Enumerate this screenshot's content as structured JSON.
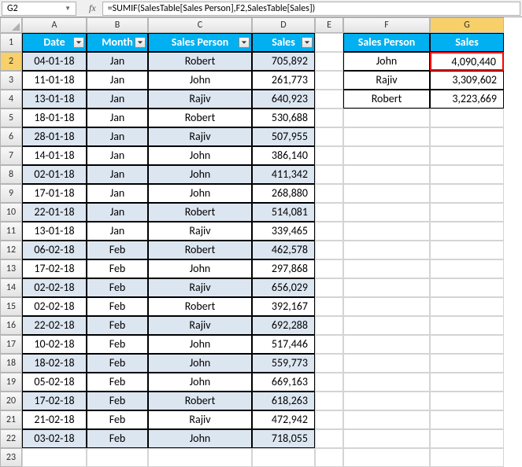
{
  "name_box": "G2",
  "fx_label": "fx",
  "formula": "=SUMIF(SalesTable[Sales Person],F2,SalesTable[Sales])",
  "columns": [
    "A",
    "B",
    "C",
    "D",
    "E",
    "F",
    "G"
  ],
  "rows": [
    "1",
    "2",
    "3",
    "4",
    "5",
    "6",
    "7",
    "8",
    "9",
    "10",
    "11",
    "12",
    "13",
    "14",
    "15",
    "16",
    "17",
    "18",
    "19",
    "20",
    "21",
    "22",
    "23"
  ],
  "selected_col": "G",
  "selected_row": "2",
  "table_headers": {
    "date": "Date",
    "month": "Month",
    "sales_person": "Sales Person",
    "sales": "Sales"
  },
  "table_rows": [
    {
      "date": "04-01-18",
      "month": "Jan",
      "person": "Robert",
      "sales": "705,892",
      "band": true
    },
    {
      "date": "11-01-18",
      "month": "Jan",
      "person": "John",
      "sales": "261,773",
      "band": false
    },
    {
      "date": "13-01-18",
      "month": "Jan",
      "person": "Rajiv",
      "sales": "640,923",
      "band": true
    },
    {
      "date": "18-01-18",
      "month": "Jan",
      "person": "Robert",
      "sales": "530,688",
      "band": false
    },
    {
      "date": "28-01-18",
      "month": "Jan",
      "person": "Rajiv",
      "sales": "507,955",
      "band": true
    },
    {
      "date": "14-01-18",
      "month": "Jan",
      "person": "John",
      "sales": "386,140",
      "band": false
    },
    {
      "date": "02-01-18",
      "month": "Jan",
      "person": "John",
      "sales": "411,342",
      "band": true
    },
    {
      "date": "17-01-18",
      "month": "Jan",
      "person": "John",
      "sales": "268,880",
      "band": false
    },
    {
      "date": "22-01-18",
      "month": "Jan",
      "person": "Robert",
      "sales": "514,081",
      "band": true
    },
    {
      "date": "13-01-18",
      "month": "Jan",
      "person": "Rajiv",
      "sales": "339,465",
      "band": false
    },
    {
      "date": "06-02-18",
      "month": "Feb",
      "person": "Robert",
      "sales": "462,578",
      "band": true
    },
    {
      "date": "17-02-18",
      "month": "Feb",
      "person": "John",
      "sales": "297,868",
      "band": false
    },
    {
      "date": "02-02-18",
      "month": "Feb",
      "person": "Rajiv",
      "sales": "656,029",
      "band": true
    },
    {
      "date": "02-02-18",
      "month": "Feb",
      "person": "Robert",
      "sales": "392,167",
      "band": false
    },
    {
      "date": "22-02-18",
      "month": "Feb",
      "person": "Rajiv",
      "sales": "692,288",
      "band": true
    },
    {
      "date": "10-02-18",
      "month": "Feb",
      "person": "John",
      "sales": "517,446",
      "band": false
    },
    {
      "date": "18-02-18",
      "month": "Feb",
      "person": "John",
      "sales": "559,773",
      "band": true
    },
    {
      "date": "05-02-18",
      "month": "Feb",
      "person": "John",
      "sales": "669,163",
      "band": false
    },
    {
      "date": "17-02-18",
      "month": "Feb",
      "person": "Robert",
      "sales": "618,263",
      "band": true
    },
    {
      "date": "21-02-18",
      "month": "Feb",
      "person": "Rajiv",
      "sales": "472,942",
      "band": false
    },
    {
      "date": "03-02-18",
      "month": "Feb",
      "person": "John",
      "sales": "718,055",
      "band": true
    }
  ],
  "summary_headers": {
    "sales_person": "Sales Person",
    "sales": "Sales"
  },
  "summary_rows": [
    {
      "person": "John",
      "sales": "4,090,440",
      "highlight": true
    },
    {
      "person": "Rajiv",
      "sales": "3,309,602",
      "highlight": false
    },
    {
      "person": "Robert",
      "sales": "3,223,669",
      "highlight": false
    }
  ],
  "chart_data": {
    "type": "table",
    "title": "SalesTable with SUMIF summary",
    "main_table": {
      "columns": [
        "Date",
        "Month",
        "Sales Person",
        "Sales"
      ],
      "rows": [
        [
          "04-01-18",
          "Jan",
          "Robert",
          705892
        ],
        [
          "11-01-18",
          "Jan",
          "John",
          261773
        ],
        [
          "13-01-18",
          "Jan",
          "Rajiv",
          640923
        ],
        [
          "18-01-18",
          "Jan",
          "Robert",
          530688
        ],
        [
          "28-01-18",
          "Jan",
          "Rajiv",
          507955
        ],
        [
          "14-01-18",
          "Jan",
          "John",
          386140
        ],
        [
          "02-01-18",
          "Jan",
          "John",
          411342
        ],
        [
          "17-01-18",
          "Jan",
          "John",
          268880
        ],
        [
          "22-01-18",
          "Jan",
          "Robert",
          514081
        ],
        [
          "13-01-18",
          "Jan",
          "Rajiv",
          339465
        ],
        [
          "06-02-18",
          "Feb",
          "Robert",
          462578
        ],
        [
          "17-02-18",
          "Feb",
          "John",
          297868
        ],
        [
          "02-02-18",
          "Feb",
          "Rajiv",
          656029
        ],
        [
          "02-02-18",
          "Feb",
          "Robert",
          392167
        ],
        [
          "22-02-18",
          "Feb",
          "Rajiv",
          692288
        ],
        [
          "10-02-18",
          "Feb",
          "John",
          517446
        ],
        [
          "18-02-18",
          "Feb",
          "John",
          559773
        ],
        [
          "05-02-18",
          "Feb",
          "John",
          669163
        ],
        [
          "17-02-18",
          "Feb",
          "Robert",
          618263
        ],
        [
          "21-02-18",
          "Feb",
          "Rajiv",
          472942
        ],
        [
          "03-02-18",
          "Feb",
          "John",
          718055
        ]
      ]
    },
    "summary_table": {
      "columns": [
        "Sales Person",
        "Sales"
      ],
      "rows": [
        [
          "John",
          4090440
        ],
        [
          "Rajiv",
          3309602
        ],
        [
          "Robert",
          3223669
        ]
      ]
    }
  }
}
